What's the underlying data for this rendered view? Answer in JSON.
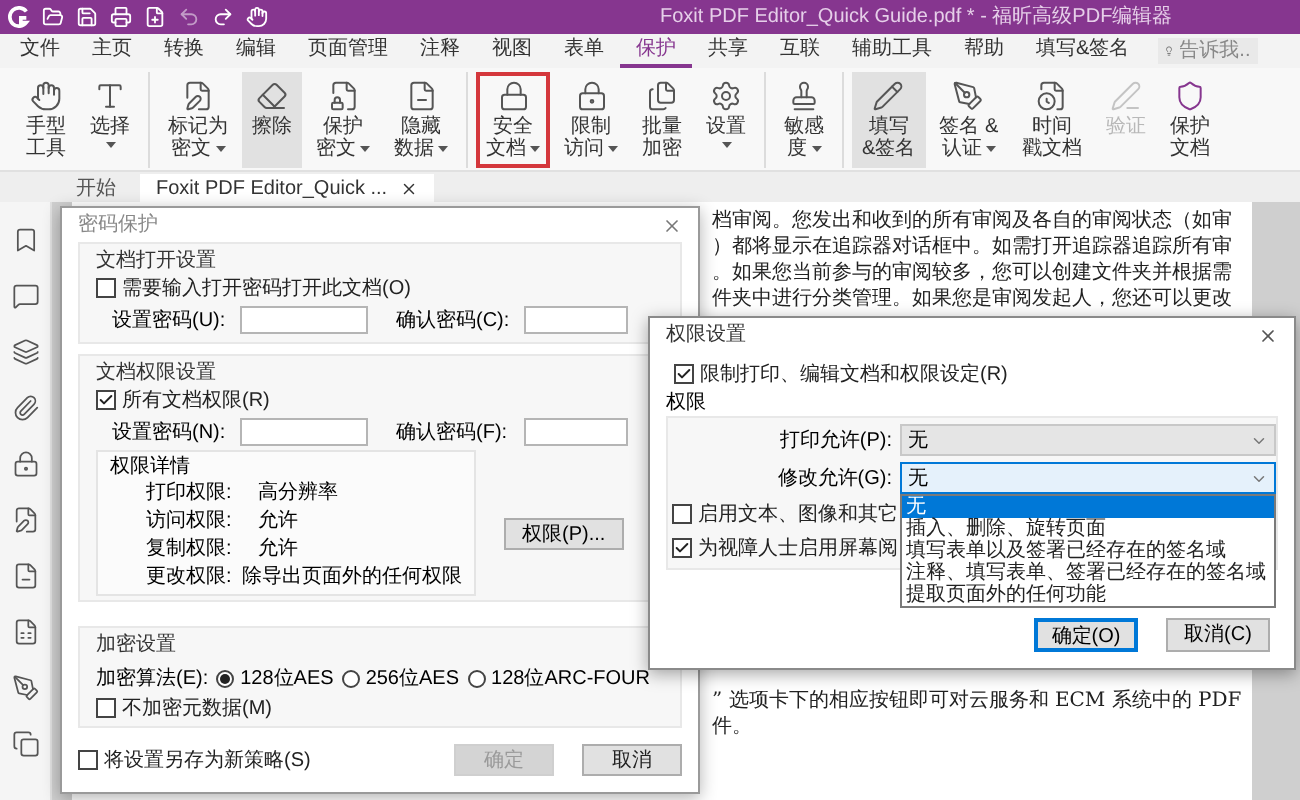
{
  "title_bar": {
    "title": "Foxit PDF Editor_Quick Guide.pdf * - 福昕高级PDF编辑器"
  },
  "menu_tabs": [
    {
      "label": "文件",
      "selected": false
    },
    {
      "label": "主页",
      "selected": false
    },
    {
      "label": "转换",
      "selected": false
    },
    {
      "label": "编辑",
      "selected": false
    },
    {
      "label": "页面管理",
      "selected": false
    },
    {
      "label": "注释",
      "selected": false
    },
    {
      "label": "视图",
      "selected": false
    },
    {
      "label": "表单",
      "selected": false
    },
    {
      "label": "保护",
      "selected": true
    },
    {
      "label": "共享",
      "selected": false
    },
    {
      "label": "互联",
      "selected": false
    },
    {
      "label": "辅助工具",
      "selected": false
    },
    {
      "label": "帮助",
      "selected": false
    },
    {
      "label": "填写&签名",
      "selected": false
    }
  ],
  "search": {
    "placeholder": "告诉我..."
  },
  "ribbon_groups": [
    [
      {
        "lines": [
          "手型",
          "工具"
        ],
        "dropdown": false,
        "pressed": false,
        "highlighted": false,
        "disabled": false
      },
      {
        "lines": [
          "选择"
        ],
        "dropdown": true,
        "pressed": false,
        "highlighted": false,
        "disabled": false
      }
    ],
    [
      {
        "lines": [
          "标记为",
          "密文"
        ],
        "dropdown": true,
        "pressed": false,
        "highlighted": false,
        "disabled": false
      },
      {
        "lines": [
          "擦除"
        ],
        "dropdown": false,
        "pressed": true,
        "highlighted": false,
        "disabled": false
      },
      {
        "lines": [
          "保护",
          "密文"
        ],
        "dropdown": true,
        "pressed": false,
        "highlighted": false,
        "disabled": false
      },
      {
        "lines": [
          "隐藏",
          "数据"
        ],
        "dropdown": true,
        "pressed": false,
        "highlighted": false,
        "disabled": false
      }
    ],
    [
      {
        "lines": [
          "安全",
          "文档"
        ],
        "dropdown": true,
        "pressed": false,
        "highlighted": true,
        "disabled": false
      },
      {
        "lines": [
          "限制",
          "访问"
        ],
        "dropdown": true,
        "pressed": false,
        "highlighted": false,
        "disabled": false
      },
      {
        "lines": [
          "批量",
          "加密"
        ],
        "dropdown": false,
        "pressed": false,
        "highlighted": false,
        "disabled": false
      },
      {
        "lines": [
          "设置"
        ],
        "dropdown": true,
        "pressed": false,
        "highlighted": false,
        "disabled": false
      }
    ],
    [
      {
        "lines": [
          "敏感",
          "度"
        ],
        "dropdown": true,
        "pressed": false,
        "highlighted": false,
        "disabled": false
      }
    ],
    [
      {
        "lines": [
          "填写",
          "&签名"
        ],
        "dropdown": false,
        "pressed": true,
        "highlighted": false,
        "disabled": false
      },
      {
        "lines": [
          "签名 &",
          "认证"
        ],
        "dropdown": true,
        "pressed": false,
        "highlighted": false,
        "disabled": false
      },
      {
        "lines": [
          "时间",
          "戳文档"
        ],
        "dropdown": false,
        "pressed": false,
        "highlighted": false,
        "disabled": false
      },
      {
        "lines": [
          "验证"
        ],
        "dropdown": false,
        "pressed": false,
        "highlighted": false,
        "disabled": true
      },
      {
        "lines": [
          "保护",
          "文档"
        ],
        "dropdown": false,
        "pressed": false,
        "highlighted": false,
        "disabled": false
      }
    ]
  ],
  "doc_tabs": [
    {
      "label": "开始",
      "selected": false,
      "closable": false
    },
    {
      "label": "Foxit PDF Editor_Quick ...",
      "selected": true,
      "closable": true
    }
  ],
  "document": {
    "lines_top": [
      "档审阅。您发出和收到的所有审阅及各自的审阅状态（如审",
      "）都将显示在追踪器对话框中。如需打开追踪器追踪所有审",
      "。如果您当前参与的审阅较多，您可以创建文件夹并根据需",
      "件夹中进行分类管理。如果您是审阅发起人，您还可以更改"
    ],
    "lines_bottom": [
      "” 选项卡下的相应按钮即可对云服务和 ECM 系统中的 PDF",
      "件。"
    ]
  },
  "password_dialog": {
    "title": "密码保护",
    "open_group": {
      "title": "文档打开设置",
      "require": {
        "label": "需要输入打开密码打开此文档(O)",
        "checked": false
      },
      "fields": [
        {
          "label": "设置密码(U):"
        },
        {
          "label": "确认密码(C):"
        }
      ]
    },
    "permission_group": {
      "title": "文档权限设置",
      "restrict": {
        "label": "所有文档权限(R)",
        "checked": true
      },
      "fields": [
        {
          "label": "设置密码(N):"
        },
        {
          "label": "确认密码(F):"
        }
      ],
      "details": {
        "title": "权限详情",
        "rows": [
          {
            "label": "打印权限:",
            "value": "高分辨率"
          },
          {
            "label": "访问权限:",
            "value": "允许"
          },
          {
            "label": "复制权限:",
            "value": "允许"
          },
          {
            "label": "更改权限:",
            "value": "除导出页面外的任何权限"
          }
        ]
      },
      "button": "权限(P)..."
    },
    "encryption_group": {
      "title": "加密设置",
      "algorithm_label": "加密算法(E):",
      "algorithms": [
        {
          "label": "128位AES",
          "selected": true
        },
        {
          "label": "256位AES",
          "selected": false
        },
        {
          "label": "128位ARC-FOUR",
          "selected": false
        }
      ],
      "no_metadata": {
        "label": "不加密元数据(M)",
        "checked": false
      }
    },
    "save_policy": {
      "label": "将设置另存为新策略(S)",
      "checked": false
    },
    "buttons": [
      {
        "label": "确定",
        "disabled": true
      },
      {
        "label": "取消",
        "disabled": false
      }
    ]
  },
  "permission_dialog": {
    "title": "权限设置",
    "restrict": {
      "label": "限制打印、编辑文档和权限设定(R)",
      "checked": true
    },
    "group_title": "权限",
    "selects": [
      {
        "label": "打印允许(P):",
        "value": "无",
        "open": false
      },
      {
        "label": "修改允许(G):",
        "value": "无",
        "open": true,
        "options": [
          {
            "label": "无",
            "selected": true
          },
          {
            "label": "插入、删除、旋转页面",
            "selected": false
          },
          {
            "label": "填写表单以及签署已经存在的签名域",
            "selected": false
          },
          {
            "label": "注释、填写表单、签署已经存在的签名域",
            "selected": false
          },
          {
            "label": "提取页面外的任何功能",
            "selected": false
          }
        ]
      }
    ],
    "checkboxes": [
      {
        "label": "启用文本、图像和其它",
        "checked": false
      },
      {
        "label": "为视障人士启用屏幕阅",
        "checked": true
      }
    ],
    "buttons": [
      {
        "label": "确定(O)",
        "default": true
      },
      {
        "label": "取消(C)",
        "default": false
      }
    ]
  }
}
